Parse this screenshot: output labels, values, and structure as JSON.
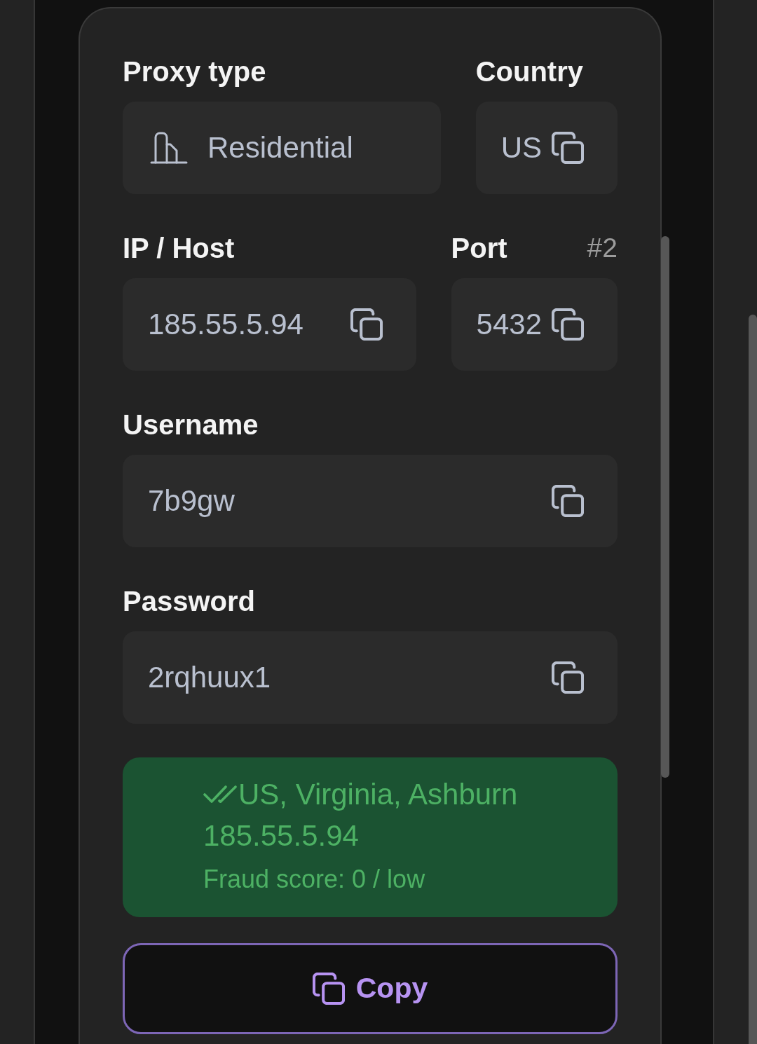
{
  "form": {
    "rows": [
      {
        "fields": [
          {
            "kind": "type",
            "label": "Proxy type",
            "value": "Residential"
          },
          {
            "kind": "copyable",
            "label": "Country",
            "value": "US"
          }
        ]
      },
      {
        "fields": [
          {
            "kind": "copyable",
            "label": "IP / Host",
            "value": "185.55.5.94"
          },
          {
            "kind": "copyable",
            "label": "Port",
            "badge": "#2",
            "value": "5432"
          }
        ]
      },
      {
        "fields": [
          {
            "kind": "copyable",
            "label": "Username",
            "value": "7b9gw"
          }
        ]
      },
      {
        "fields": [
          {
            "kind": "copyable",
            "label": "Password",
            "value": "2rqhuux1"
          }
        ]
      }
    ]
  },
  "check_result": {
    "passed": true,
    "location": "US, Virginia, Ashburn",
    "ip": "185.55.5.94",
    "fraud_score": "Fraud score: 0 / low"
  },
  "copy_button": {
    "label": "Copy"
  }
}
